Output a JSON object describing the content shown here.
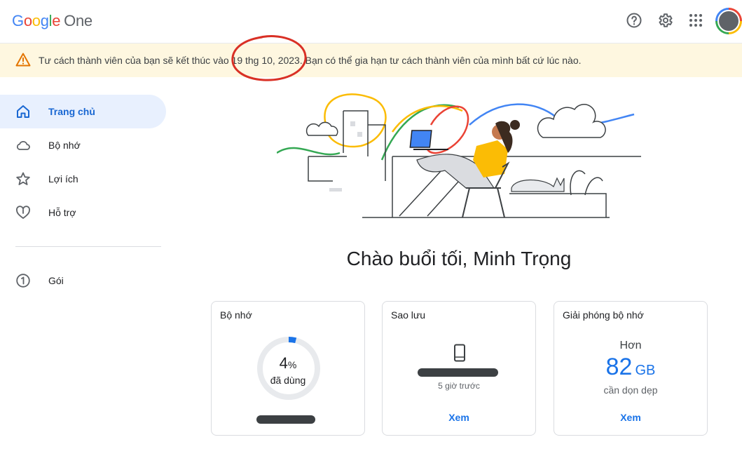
{
  "brand": {
    "g": [
      "G",
      "o",
      "o",
      "g",
      "l",
      "e"
    ],
    "product": "One"
  },
  "header": {
    "icons": [
      "help-icon",
      "settings-icon",
      "apps-grid-icon",
      "account-avatar"
    ]
  },
  "banner": {
    "text": "Tư cách thành viên của bạn sẽ kết thúc vào 19 thg 10, 2023. Bạn có thể gia hạn tư cách thành viên của mình bất cứ lúc nào.",
    "accent": "#fef7e0",
    "annotation_color": "#d93025"
  },
  "sidebar": {
    "items": [
      {
        "label": "Trang chủ",
        "icon": "home-icon",
        "active": true
      },
      {
        "label": "Bộ nhớ",
        "icon": "cloud-icon"
      },
      {
        "label": "Lợi ích",
        "icon": "star-icon"
      },
      {
        "label": "Hỗ trợ",
        "icon": "heart-support-icon"
      }
    ],
    "plan": {
      "label": "Gói",
      "icon": "plan-one-icon"
    }
  },
  "greeting": "Chào buổi tối, Minh Trọng",
  "cards": {
    "storage": {
      "title": "Bộ nhớ",
      "percent": "4",
      "unit": "%",
      "used_label": "đã dùng",
      "percent_value": 4
    },
    "backup": {
      "title": "Sao lưu",
      "ago": "5 giờ trước",
      "link": "Xem"
    },
    "free_up": {
      "title": "Giải phóng bộ nhớ",
      "more": "Hơn",
      "amount": "82",
      "unit": "GB",
      "sub": "cần dọn dẹp",
      "link": "Xem"
    }
  },
  "colors": {
    "primary": "#1a73e8",
    "active_bg": "#e8f0fe"
  }
}
